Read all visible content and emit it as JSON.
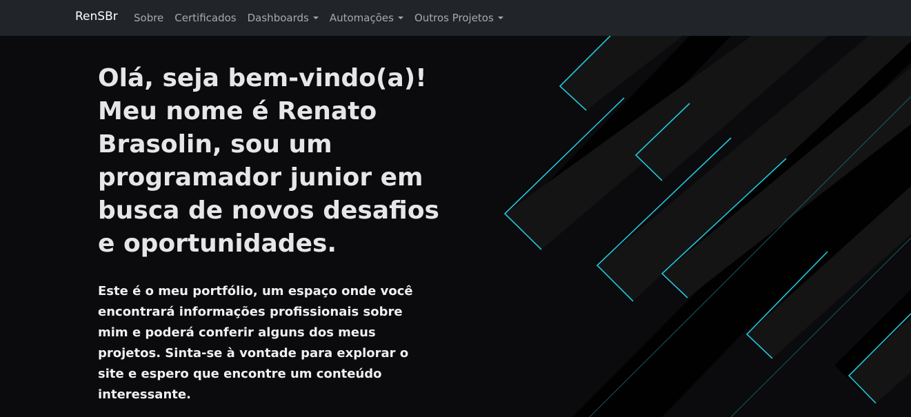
{
  "navbar": {
    "brand": "RenSBr",
    "items": [
      {
        "label": "Sobre",
        "dropdown": false
      },
      {
        "label": "Certificados",
        "dropdown": false
      },
      {
        "label": "Dashboards",
        "dropdown": true
      },
      {
        "label": "Automações",
        "dropdown": true
      },
      {
        "label": "Outros Projetos",
        "dropdown": true
      }
    ]
  },
  "hero": {
    "title": "Olá, seja bem-vindo(a)! Meu nome é Renato Brasolin, sou um programador junior em busca de novos desafios e oportunidades.",
    "paragraph": "Este é o meu portfólio, um espaço onde você encontrará informações profissionais sobre mim e poderá conferir alguns dos meus projetos. Sinta-se à vontade para explorar o site e espero que encontre um conteúdo interessante."
  },
  "colors": {
    "navbar_bg": "#212529",
    "page_bg": "#0b0a0d",
    "accent": "#20c9dc"
  }
}
